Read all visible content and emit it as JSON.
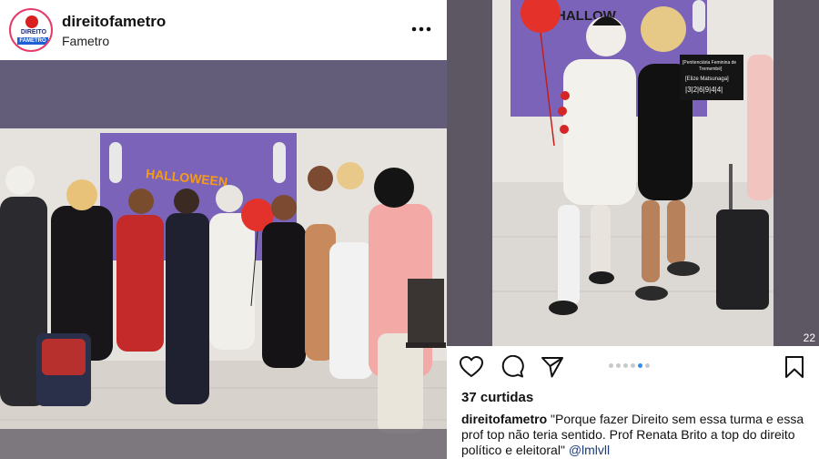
{
  "left_post": {
    "username": "direitofametro",
    "location": "Fametro",
    "avatar_label_top": "DIREITO",
    "avatar_label_band": "FAMETRO",
    "photo_banner_text": "HALLOWEEN"
  },
  "right_post": {
    "photo_banner_text": "HALLOW",
    "sign_line1": "[Penitenciária Feminina de",
    "sign_line2": "Tremembé]",
    "sign_line3": "[Elize Matsunaga]",
    "sign_line4": "|3|2|6|9|4|4|",
    "image_count": "22",
    "likes": "37 curtidas",
    "caption_username": "direitofametro",
    "caption_text": "\"Porque fazer Direito sem essa turma e essa prof top não teria sentido. Prof Renata Brito a top do direito político e eleitoral\"",
    "caption_mention": "@lmlvll"
  },
  "colors": {
    "accent_blue": "#2f8ef4",
    "mention": "#1a3d7c",
    "wall_purple": "#7a63b8"
  },
  "icons": [
    "more-icon",
    "heart-icon",
    "comment-icon",
    "share-icon",
    "bookmark-icon"
  ]
}
